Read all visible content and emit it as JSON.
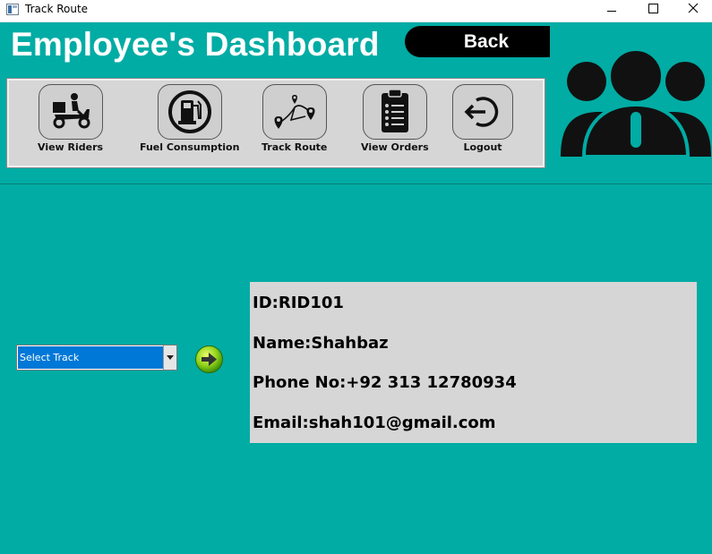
{
  "window": {
    "title": "Track Route"
  },
  "header": {
    "title": "Employee's Dashboard",
    "back_label": "Back"
  },
  "toolbar": {
    "items": [
      {
        "label": "View Riders",
        "icon": "scooter-delivery-icon"
      },
      {
        "label": "Fuel Consumption",
        "icon": "fuel-pump-icon"
      },
      {
        "label": "Track Route",
        "icon": "route-map-icon"
      },
      {
        "label": "View Orders",
        "icon": "clipboard-list-icon"
      },
      {
        "label": "Logout",
        "icon": "logout-icon"
      }
    ]
  },
  "track_select": {
    "value": "Select Track"
  },
  "rider": {
    "id_line": "ID:RID101",
    "name_line": "Name:Shahbaz",
    "phone_line": "Phone No:+92 313 12780934",
    "email_line": "Email:shah101@gmail.com"
  },
  "colors": {
    "background": "#00aca4",
    "panel": "#d6d6d6",
    "icon_teal": "#00aca4"
  }
}
